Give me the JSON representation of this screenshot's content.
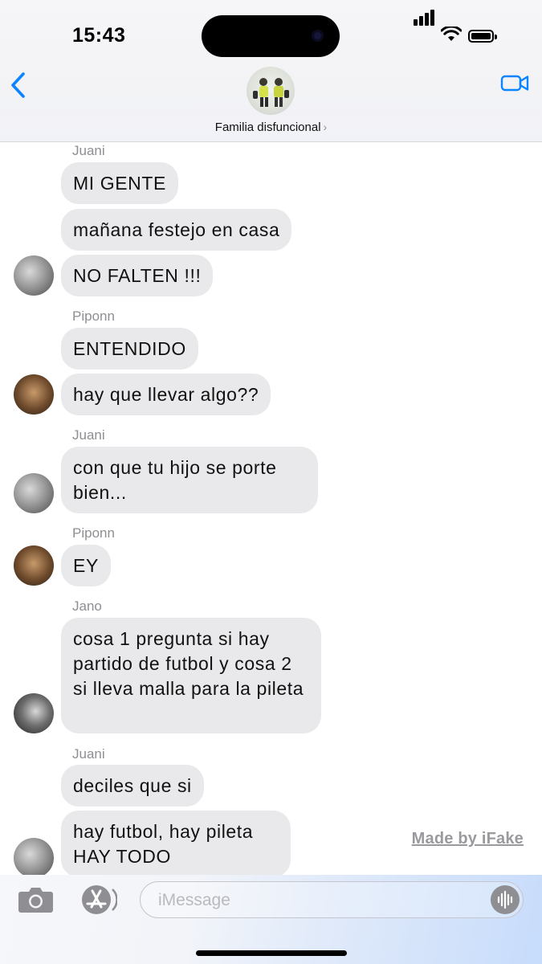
{
  "status_bar": {
    "time": "15:43"
  },
  "header": {
    "group_name": "Familia disfuncional",
    "chevron": "›",
    "back_icon": "chevron-left-icon",
    "video_icon": "video-camera-icon"
  },
  "colors": {
    "accent": "#0a84ff",
    "bubble": "#e9e9eb",
    "sender_label": "#8e8e93"
  },
  "thread": {
    "items": [
      {
        "type": "sender",
        "text": "Juani"
      },
      {
        "type": "message",
        "text": "MI GENTE"
      },
      {
        "type": "message",
        "text": "mañana festejo en casa"
      },
      {
        "type": "message",
        "text": "NO FALTEN !!!",
        "avatar": "Juani"
      },
      {
        "type": "sender",
        "text": "Piponn"
      },
      {
        "type": "message",
        "text": "ENTENDIDO"
      },
      {
        "type": "message",
        "text": "hay que llevar algo??",
        "avatar": "Piponn"
      },
      {
        "type": "sender",
        "text": "Juani"
      },
      {
        "type": "message",
        "text": "con que tu hijo se porte bien...",
        "avatar": "Juani"
      },
      {
        "type": "sender",
        "text": "Piponn"
      },
      {
        "type": "message",
        "text": "EY",
        "avatar": "Piponn"
      },
      {
        "type": "sender",
        "text": "Jano"
      },
      {
        "type": "message",
        "text": "cosa 1 pregunta si hay partido de futbol y cosa 2 si lleva malla para la pileta",
        "avatar": "Jano"
      },
      {
        "type": "sender",
        "text": "Juani"
      },
      {
        "type": "message",
        "text": "deciles que si"
      },
      {
        "type": "message",
        "text": "hay futbol, hay pileta HAY TODO",
        "avatar": "Juani"
      }
    ]
  },
  "watermark": "Made by iFake",
  "input_bar": {
    "placeholder": "iMessage",
    "icons": [
      "camera-icon",
      "app-store-icon",
      "waveform-icon"
    ]
  }
}
